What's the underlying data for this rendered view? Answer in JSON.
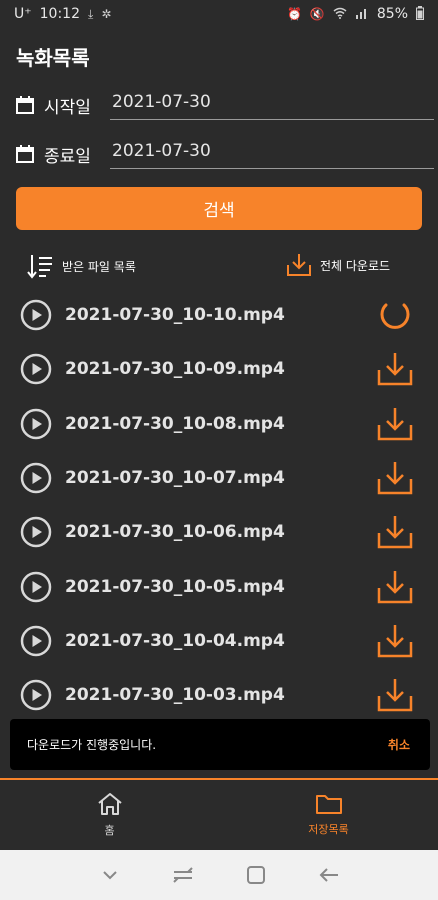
{
  "status_bar": {
    "carrier": "U⁺",
    "time": "10:12",
    "battery": "85%",
    "left_icons": [
      "download-icon",
      "settings-icon"
    ],
    "right_icons": [
      "alarm-icon",
      "mute-icon",
      "wifi-icon",
      "signal-icon"
    ]
  },
  "page": {
    "title": "녹화목록"
  },
  "filters": {
    "start": {
      "label": "시작일",
      "value": "2021-07-30"
    },
    "end": {
      "label": "종료일",
      "value": "2021-07-30"
    }
  },
  "search_button": {
    "label": "검색"
  },
  "toolbar": {
    "sort_label": "받은 파일 목록",
    "download_all_label": "전체 다운로드"
  },
  "files": [
    {
      "name": "2021-07-30_10-10.mp4",
      "state": "loading"
    },
    {
      "name": "2021-07-30_10-09.mp4",
      "state": "download"
    },
    {
      "name": "2021-07-30_10-08.mp4",
      "state": "download"
    },
    {
      "name": "2021-07-30_10-07.mp4",
      "state": "download"
    },
    {
      "name": "2021-07-30_10-06.mp4",
      "state": "download"
    },
    {
      "name": "2021-07-30_10-05.mp4",
      "state": "download"
    },
    {
      "name": "2021-07-30_10-04.mp4",
      "state": "download"
    },
    {
      "name": "2021-07-30_10-03.mp4",
      "state": "download"
    }
  ],
  "snackbar": {
    "message": "다운로드가 진행중입니다.",
    "action": "취소"
  },
  "bottom_nav": [
    {
      "label": "홈",
      "icon": "home-icon",
      "active": false
    },
    {
      "label": "저장목록",
      "icon": "folder-icon",
      "active": true
    }
  ],
  "colors": {
    "accent": "#f7832a",
    "background": "#2b2b2b",
    "text": "#e4e4e4"
  }
}
